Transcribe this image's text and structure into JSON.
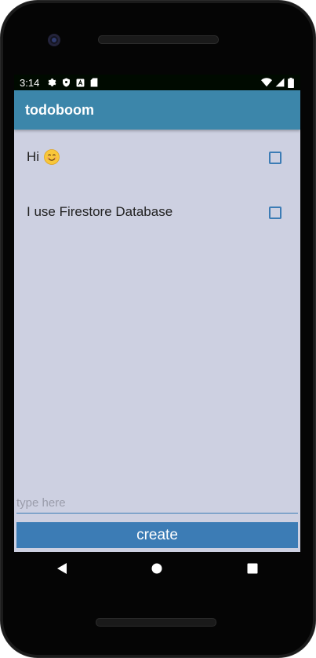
{
  "status_bar": {
    "time": "3:14",
    "left_icons": [
      "gear-icon",
      "shield-icon",
      "font-icon",
      "sd-card-icon"
    ],
    "right_icons": [
      "wifi-icon",
      "signal-icon",
      "battery-icon"
    ]
  },
  "app_bar": {
    "title": "todoboom"
  },
  "todos": [
    {
      "text": "Hi",
      "emoji": "smiling-face-icon",
      "checked": false
    },
    {
      "text": "I use Firestore Database",
      "checked": false
    }
  ],
  "input": {
    "value": "",
    "placeholder": "type here"
  },
  "create_button": {
    "label": "create"
  },
  "nav_bar": {
    "buttons": [
      "back-icon",
      "home-icon",
      "recents-icon"
    ]
  },
  "colors": {
    "app_bar": "#3c86aa",
    "background": "#cdd0e1",
    "accent": "#3c7cb5"
  }
}
